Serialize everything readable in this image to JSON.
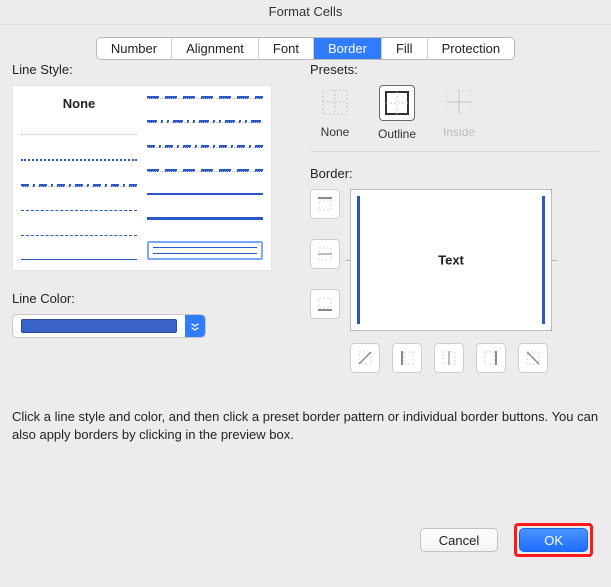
{
  "title": "Format Cells",
  "tabs": [
    "Number",
    "Alignment",
    "Font",
    "Border",
    "Fill",
    "Protection"
  ],
  "active_tab": "Border",
  "left": {
    "line_style_label": "Line Style:",
    "none_label": "None",
    "line_color_label": "Line Color:",
    "selected_color": "#3a63c8"
  },
  "right": {
    "presets_label": "Presets:",
    "preset_none": "None",
    "preset_outline": "Outline",
    "preset_inside": "Inside",
    "border_label": "Border:",
    "preview_text": "Text"
  },
  "help_text": "Click a line style and color, and then click a preset border pattern or individual border buttons. You can also apply borders by clicking in the preview box.",
  "footer": {
    "cancel": "Cancel",
    "ok": "OK"
  }
}
